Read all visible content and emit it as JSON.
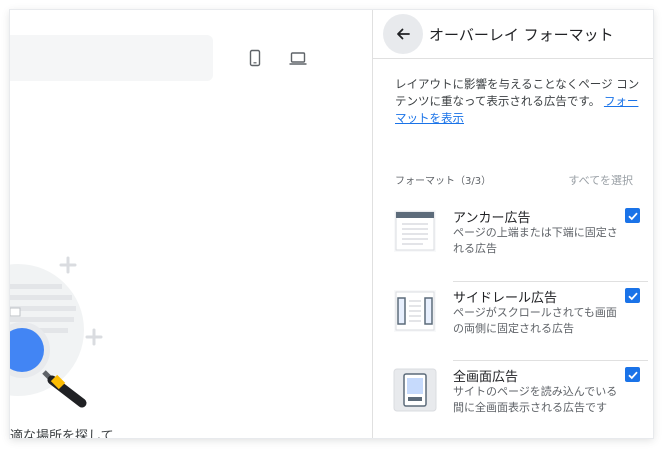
{
  "left": {
    "footer_text": "適な場所を探して"
  },
  "panel": {
    "title": "オーバーレイ フォーマット",
    "description": "レイアウトに影響を与えることなくページ コンテンツに重なって表示される広告です。",
    "description_link": "フォーマットを表示",
    "section_label": "フォーマット（3/3）",
    "select_all": "すべてを選択",
    "items": [
      {
        "title": "アンカー広告",
        "subtitle": "ページの上端または下端に固定される広告",
        "checked": true,
        "icon": "anchor-ad-icon"
      },
      {
        "title": "サイドレール広告",
        "subtitle": "ページがスクロールされても画面の両側に固定される広告",
        "checked": true,
        "icon": "side-rail-ad-icon"
      },
      {
        "title": "全画面広告",
        "subtitle": "サイトのページを読み込んでいる間に全画面表示される広告です",
        "checked": true,
        "icon": "vignette-ad-icon"
      }
    ]
  },
  "colors": {
    "accent": "#1a73e8",
    "divider": "#e0e0e0",
    "back_button_bg": "#e8eaed"
  }
}
